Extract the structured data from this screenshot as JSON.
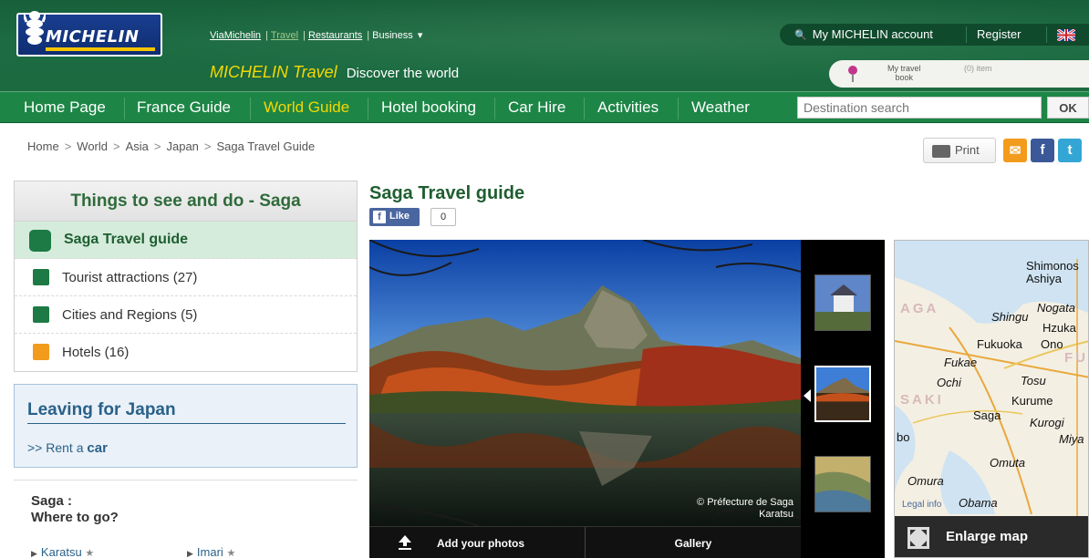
{
  "header": {
    "brand": "MICHELIN",
    "top_links": [
      "ViaMichelin",
      "Travel",
      "Restaurants",
      "Business"
    ],
    "business_suffix": "▾",
    "tagline_brand": "MICHELIN Travel",
    "tagline_sub": "Discover the world",
    "account": "My MICHELIN account",
    "register": "Register",
    "my_travel": "My travel",
    "my_travel_sub": "book",
    "item_count": "(0) item"
  },
  "nav": {
    "items": [
      "Home Page",
      "France Guide",
      "World Guide",
      "Hotel booking",
      "Car Hire",
      "Activities",
      "Weather"
    ],
    "active": "World Guide",
    "search_placeholder": "Destination search",
    "ok": "OK"
  },
  "breadcrumb": [
    "Home",
    "World",
    "Asia",
    "Japan",
    "Saga Travel Guide"
  ],
  "breadcrumb_sep": ">",
  "tools": {
    "print": "Print"
  },
  "sidebar": {
    "things_title": "Things to see and do - Saga",
    "items": [
      {
        "label": "Saga Travel guide",
        "icon": "guide-icon"
      },
      {
        "label": "Tourist attractions (27)",
        "icon": "monument-icon"
      },
      {
        "label": "Cities and Regions (5)",
        "icon": "city-icon"
      },
      {
        "label": "Hotels (16)",
        "icon": "hotel-icon"
      }
    ],
    "leaving_title": "Leaving for Japan",
    "rent_prefix": ">> Rent a",
    "rent_link": "car",
    "where_line1": "Saga :",
    "where_line2": "Where to go?",
    "places": [
      "Karatsu",
      "Imari"
    ],
    "star": "★"
  },
  "main": {
    "title": "Saga Travel guide",
    "like": "Like",
    "like_count": "0",
    "credit_line1": "© Préfecture de Saga",
    "credit_line2": "Karatsu",
    "add_photos": "Add your photos",
    "gallery": "Gallery"
  },
  "map": {
    "labels": [
      "Shimonos",
      "Ashiya",
      "Nogata",
      "Shingu",
      "Hzuka",
      "Fukuoka",
      "Ono",
      "Fukae",
      "Ochi",
      "Tosu",
      "Kurume",
      "Saga",
      "Kurogi",
      "Miya",
      "bo",
      "Omuta",
      "Omura",
      "Obama"
    ],
    "regions": [
      "AGA",
      "SAKI",
      "FU"
    ],
    "legal": "Legal info",
    "enlarge": "Enlarge map"
  },
  "colors": {
    "header_green": "#1c6b42",
    "nav_green": "#1d8646",
    "accent_yellow": "#f5d800",
    "title_green": "#1f5e31",
    "link_blue": "#2a6189"
  }
}
